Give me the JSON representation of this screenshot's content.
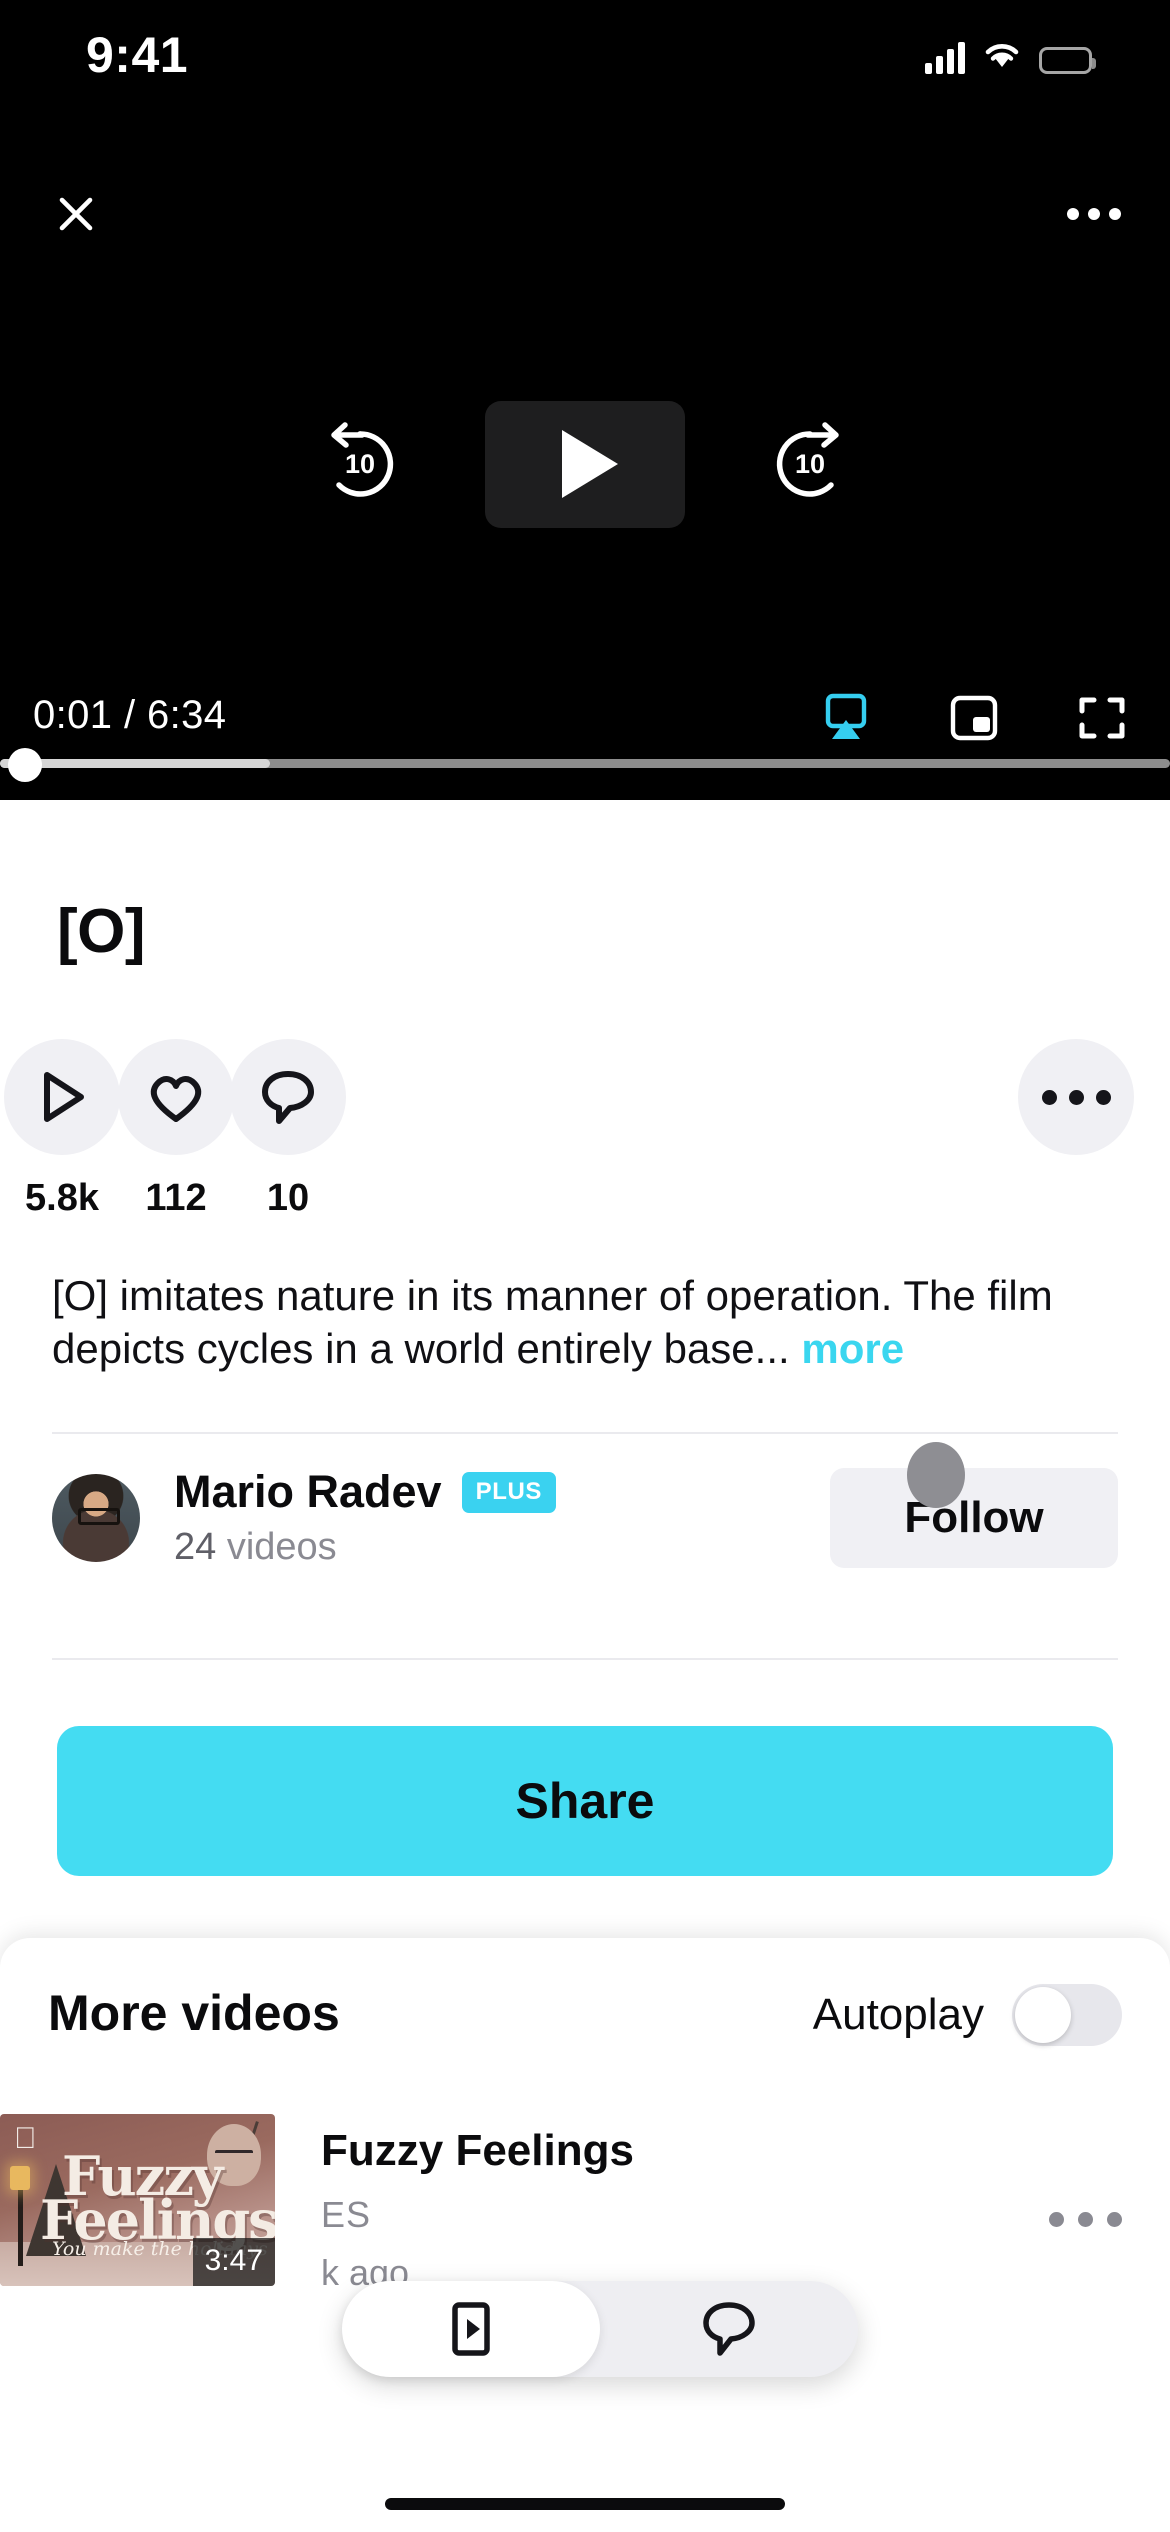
{
  "status_bar": {
    "time": "9:41",
    "signal_icon": "cellular-signal-icon",
    "wifi_icon": "wifi-icon",
    "battery_icon": "battery-icon"
  },
  "player": {
    "close_icon": "close-icon",
    "more_icon": "more-options-icon",
    "rewind_label": "10",
    "forward_label": "10",
    "rewind_icon": "rewind-10-icon",
    "forward_icon": "forward-10-icon",
    "play_icon": "play-icon",
    "time_display": "0:01 / 6:34",
    "current_time": "0:01",
    "duration": "6:34",
    "airplay_icon": "airplay-icon",
    "pip_icon": "picture-in-picture-icon",
    "fullscreen_icon": "fullscreen-icon",
    "progress_percent": 0,
    "buffered_percent": 23,
    "accent_color": "#3ad2f0"
  },
  "video": {
    "title": "[O]",
    "stats": [
      {
        "icon": "play-outline-icon",
        "value": "5.8k",
        "name": "plays"
      },
      {
        "icon": "heart-outline-icon",
        "value": "112",
        "name": "likes"
      },
      {
        "icon": "comment-outline-icon",
        "value": "10",
        "name": "comments"
      }
    ],
    "overflow_icon": "more-options-icon",
    "description": "[O] imitates nature in its manner of operation. The film depicts cycles in a world entirely base...",
    "more_label": "more"
  },
  "creator": {
    "avatar_icon": "user-avatar",
    "name": "Mario Radev",
    "badge": "PLUS",
    "video_count": "24",
    "video_count_suffix": " videos",
    "follow_label": "Follow",
    "cursor_icon": "touch-cursor-indicator"
  },
  "share": {
    "label": "Share",
    "color": "#44dcf2"
  },
  "more_videos": {
    "heading": "More videos",
    "autoplay_label": "Autoplay",
    "autoplay_on": false,
    "items": [
      {
        "title": "Fuzzy Feelings",
        "thumb_title_line1": "Fuzzy",
        "thumb_title_line2": "Feelings",
        "thumb_subtitle": "You make the holidays",
        "thumb_brand_icon": "apple-logo-icon",
        "duration": "3:47",
        "channel": "ES",
        "uploaded": "k ago",
        "overflow_icon": "more-options-icon"
      }
    ]
  },
  "tab_bar": {
    "tabs": [
      {
        "icon": "video-tab-icon",
        "active": true
      },
      {
        "icon": "comment-tab-icon",
        "active": false
      }
    ]
  },
  "home_indicator": "home-indicator"
}
